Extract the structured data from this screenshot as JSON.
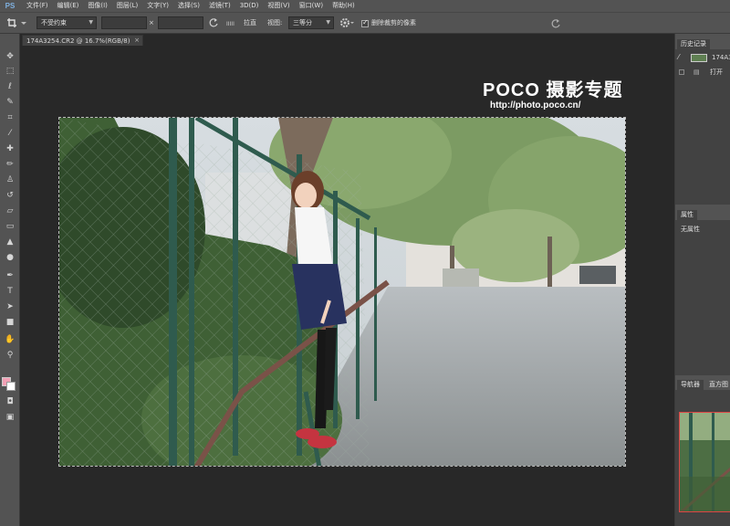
{
  "app": {
    "logo_text": "PS"
  },
  "menu": {
    "items": [
      "文件(F)",
      "编辑(E)",
      "图像(I)",
      "图层(L)",
      "文字(Y)",
      "选择(S)",
      "滤镜(T)",
      "3D(D)",
      "视图(V)",
      "窗口(W)",
      "帮助(H)"
    ]
  },
  "options": {
    "crop_tool_icon": "crop-icon",
    "constraint": "不受约束",
    "straighten_label": "拉直",
    "view_label": "视图:",
    "view_value": "三等分",
    "delete_cropped_label": "删除裁剪的像素",
    "delete_cropped_checked": true,
    "swap_symbol": "×"
  },
  "document": {
    "tab_title": "174A3254.CR2 @ 16.7%(RGB/8)",
    "close_symbol": "×"
  },
  "watermark": {
    "logo": "POCO 摄影专题",
    "url": "http://photo.poco.cn/"
  },
  "panels": {
    "history_tab": "历史记录",
    "history_items": [
      {
        "label": "174A3"
      },
      {
        "label": "打开"
      }
    ],
    "properties_tab": "属性",
    "properties_text": "无属性",
    "navigator_tab": "导航器",
    "histogram_tab": "直方图"
  },
  "colors": {
    "foreground": "#f2a0b5",
    "background": "#ffffff"
  }
}
